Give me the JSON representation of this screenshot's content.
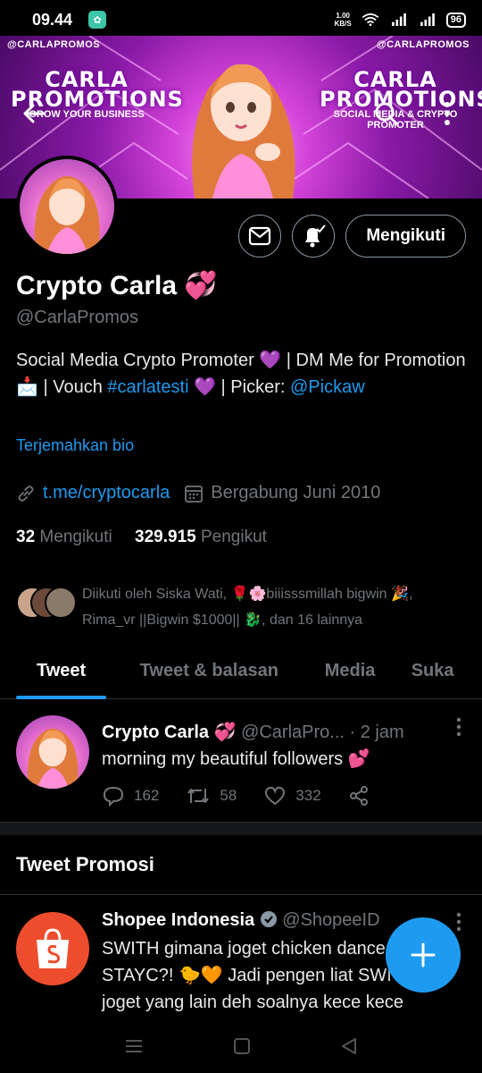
{
  "status_bar": {
    "time": "09.44",
    "net_speed": "1.00",
    "net_unit": "KB/S",
    "battery": "96"
  },
  "banner": {
    "handle_left": "@CARLAPROMOS",
    "handle_right": "@CARLAPROMOS",
    "left_title_1": "CARLA",
    "left_title_2": "PROMOTIONS",
    "left_sub": "GROW YOUR BUSINESS",
    "right_title_1": "CARLA",
    "right_title_2": "PROMOTIONS",
    "right_sub": "SOCIAL MEDIA & CRYPTO PROMOTER"
  },
  "profile": {
    "name": "Crypto Carla",
    "name_emoji": "💞",
    "handle": "@CarlaPromos",
    "bio_1": "Social Media Crypto Promoter 💜 | DM Me for Promotion 📩 | Vouch ",
    "bio_hashtag": "#carlatesti",
    "bio_2": " 💜 | Picker: ",
    "bio_mention": "@Pickaw",
    "translate": "Terjemahkan bio",
    "link": "t.me/cryptocarla",
    "joined": "Bergabung Juni 2010",
    "following_count": "32",
    "following_label": "Mengikuti",
    "followers_count": "329.915",
    "followers_label": "Pengikut",
    "followed_by": "Diikuti oleh Siska Wati, 🌹🌸biiisssmillah bigwin 🎉, Rima_vr ||Bigwin $1000|| 🐉, dan 16 lainnya",
    "follow_button": "Mengikuti"
  },
  "tabs": [
    "Tweet",
    "Tweet & balasan",
    "Media",
    "Suka"
  ],
  "tweet": {
    "name": "Crypto Carla",
    "emoji": "💞",
    "handle": "@CarlaPro...",
    "time": "· 2 jam",
    "text": "morning my beautiful followers 💕",
    "replies": "162",
    "retweets": "58",
    "likes": "332"
  },
  "promoted": {
    "section_title": "Tweet Promosi",
    "name": "Shopee Indonesia",
    "handle": "@ShopeeID",
    "text": "SWITH gimana joget chicken dance STAYC?! 🐤🧡 Jadi pengen liat SWITH joget yang lain deh soalnya kece kece"
  },
  "colors": {
    "accent": "#1d9bf0",
    "background": "#000000",
    "muted": "#71767b",
    "shopee": "#ee4d2d"
  }
}
